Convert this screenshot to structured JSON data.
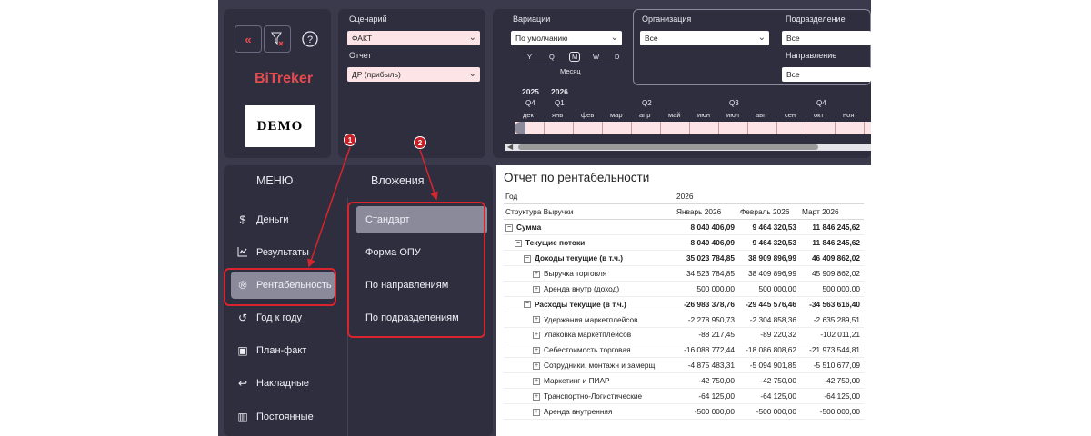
{
  "toolbar": {
    "back_icon": "double-chevron-left",
    "filter_clear_icon": "filter-clear",
    "help_icon": "question-circle"
  },
  "brand": {
    "name": "BiTreker",
    "logo_text": "DEMO"
  },
  "filters": {
    "scenario_label": "Сценарий",
    "scenario_value": "ФАКТ",
    "report_label": "Отчет",
    "report_value": "ДР (прибыль)",
    "variations_label": "Вариации",
    "variations_value": "По умолчанию",
    "granularity": [
      "Y",
      "Q",
      "M",
      "W",
      "D"
    ],
    "granularity_selected": "M",
    "granularity_caption": "Месяц",
    "org_label": "Организация",
    "org_value": "Все",
    "dept_label": "Подразделение",
    "dept_value": "Все",
    "direction_label": "Направление",
    "direction_value": "Все"
  },
  "timeline": {
    "years": [
      "2025",
      "2026"
    ],
    "quarters": [
      "Q4",
      "Q1",
      "Q2",
      "Q3",
      "Q4"
    ],
    "months": [
      "дек",
      "янв",
      "фев",
      "мар",
      "апр",
      "май",
      "июн",
      "июл",
      "авг",
      "сен",
      "окт",
      "ноя"
    ]
  },
  "menu": {
    "title": "МЕНЮ",
    "items": [
      {
        "label": "Деньги",
        "icon": "dollar-circle"
      },
      {
        "label": "Результаты",
        "icon": "chart-line"
      },
      {
        "label": "Рентабельность",
        "icon": "registered-circle"
      },
      {
        "label": "Год к году",
        "icon": "history"
      },
      {
        "label": "План-факт",
        "icon": "image-chart"
      },
      {
        "label": "Накладные",
        "icon": "return-arrow"
      },
      {
        "label": "Постоянные",
        "icon": "bars"
      }
    ]
  },
  "submenu": {
    "title": "Вложения",
    "items": [
      {
        "label": "Стандарт"
      },
      {
        "label": "Форма ОПУ"
      },
      {
        "label": "По направлениям"
      },
      {
        "label": "По подразделениям"
      }
    ]
  },
  "annotations": {
    "badge1": "1",
    "badge2": "2",
    "highlight_color": "#d8242c"
  },
  "report": {
    "title": "Отчет по рентабельности",
    "year_label": "Год",
    "year_value": "2026",
    "structure_label": "Структура Выручки",
    "columns": [
      "Январь 2026",
      "Февраль 2026",
      "Март 2026"
    ],
    "rows": [
      {
        "label": "Сумма",
        "values": [
          "8 040 406,09",
          "9 464 320,53",
          "11 846 245,62"
        ]
      },
      {
        "label": "Текущие потоки",
        "values": [
          "8 040 406,09",
          "9 464 320,53",
          "11 846 245,62"
        ]
      },
      {
        "label": "Доходы текущие (в т.ч.)",
        "values": [
          "35 023 784,85",
          "38 909 896,99",
          "46 409 862,02"
        ]
      },
      {
        "label": "Выручка торговля",
        "values": [
          "34 523 784,85",
          "38 409 896,99",
          "45 909 862,02"
        ]
      },
      {
        "label": "Аренда внутр (доход)",
        "values": [
          "500 000,00",
          "500 000,00",
          "500 000,00"
        ]
      },
      {
        "label": "Расходы текущие (в т.ч.)",
        "values": [
          "-26 983 378,76",
          "-29 445 576,46",
          "-34 563 616,40"
        ]
      },
      {
        "label": "Удержания маркетплейсов",
        "values": [
          "-2 278 950,73",
          "-2 304 858,36",
          "-2 635 289,51"
        ]
      },
      {
        "label": "Упаковка маркетплейсов",
        "values": [
          "-88 217,45",
          "-89 220,32",
          "-102 011,21"
        ]
      },
      {
        "label": "Себестоимость торговая",
        "values": [
          "-16 088 772,44",
          "-18 086 808,62",
          "-21 973 544,81"
        ]
      },
      {
        "label": "Сотрудники, монтажн и замерщ",
        "values": [
          "-4 875 483,31",
          "-5 094 901,85",
          "-5 510 677,09"
        ]
      },
      {
        "label": "Маркетинг и ПИАР",
        "values": [
          "-42 750,00",
          "-42 750,00",
          "-42 750,00"
        ]
      },
      {
        "label": "Транспортно-Логистические",
        "values": [
          "-64 125,00",
          "-64 125,00",
          "-64 125,00"
        ]
      },
      {
        "label": "Аренда внутренняя",
        "values": [
          "-500 000,00",
          "-500 000,00",
          "-500 000,00"
        ]
      }
    ]
  }
}
